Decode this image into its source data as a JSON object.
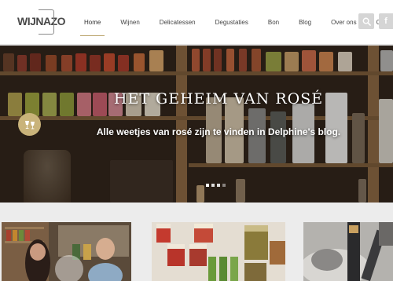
{
  "header": {
    "logo_text": "WIJNAZO",
    "nav": [
      {
        "label": "Home",
        "active": true
      },
      {
        "label": "Wijnen",
        "active": false
      },
      {
        "label": "Delicatessen",
        "active": false
      },
      {
        "label": "Degustaties",
        "active": false
      },
      {
        "label": "Bon",
        "active": false
      },
      {
        "label": "Blog",
        "active": false
      },
      {
        "label": "Over ons",
        "active": false
      },
      {
        "label": "Contact",
        "active": false
      }
    ],
    "icons": {
      "search": "search-icon",
      "social": "facebook-icon"
    }
  },
  "hero": {
    "title": "HET GEHEIM VAN ROSÉ",
    "subtitle": "Alle weetjes van rosé zijn te vinden in Delphine's blog.",
    "slides": 4,
    "active_slide": 1,
    "side_icon": "wine-glasses-icon"
  },
  "colors": {
    "accent": "#c9b37a",
    "nav_underline": "#b9a36a",
    "header_bg": "#ffffff",
    "page_bg": "#ececec"
  }
}
